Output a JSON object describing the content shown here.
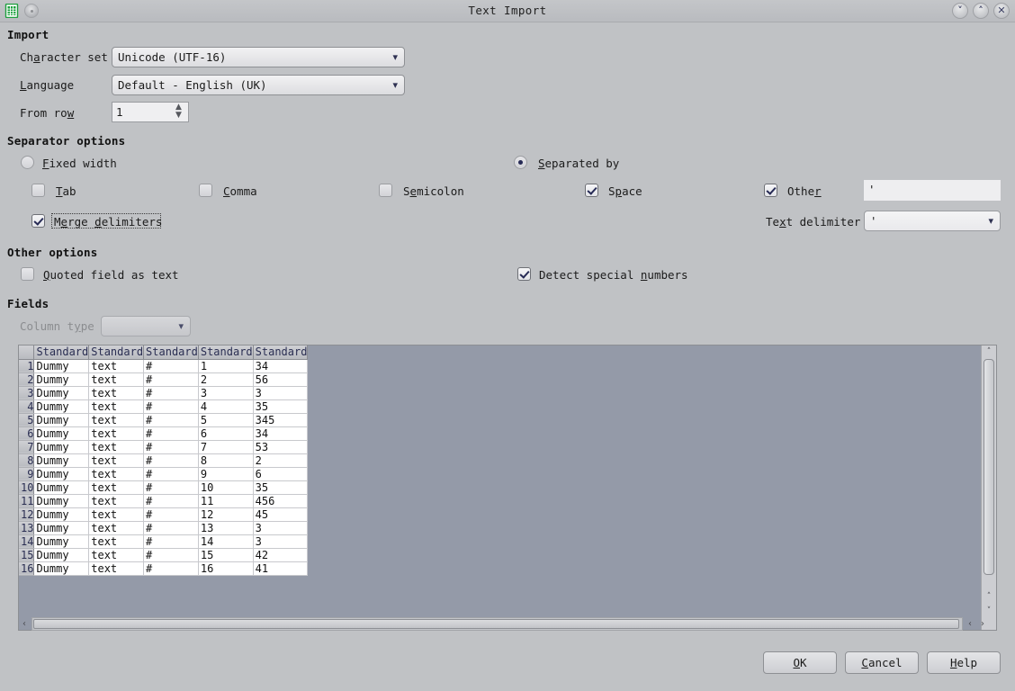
{
  "window": {
    "title": "Text Import",
    "app_icon": "calc-document-icon",
    "extra_icon": "round-button-icon",
    "controls": {
      "minimize": "˅",
      "maximize": "˄",
      "close": "✕"
    }
  },
  "import": {
    "heading": "Import",
    "charset_label": "Character set",
    "charset_value": "Unicode (UTF-16)",
    "language_label": "Language",
    "language_value": "Default - English (UK)",
    "fromrow_label": "From row",
    "fromrow_value": "1"
  },
  "separator": {
    "heading": "Separator options",
    "fixed_width_label": "Fixed width",
    "fixed_width_checked": false,
    "separated_by_label": "Separated by",
    "separated_by_checked": true,
    "tab_label": "Tab",
    "tab_checked": false,
    "comma_label": "Comma",
    "comma_checked": false,
    "semicolon_label": "Semicolon",
    "semicolon_checked": false,
    "space_label": "Space",
    "space_checked": true,
    "other_label": "Other",
    "other_checked": true,
    "other_value": "'",
    "merge_label": "Merge delimiters",
    "merge_checked": true,
    "text_delimiter_label": "Text delimiter",
    "text_delimiter_value": "'"
  },
  "other_options": {
    "heading": "Other options",
    "quoted_label": "Quoted field as text",
    "quoted_checked": false,
    "detect_label": "Detect special numbers",
    "detect_checked": true
  },
  "fields": {
    "heading": "Fields",
    "column_type_label": "Column type",
    "column_type_value": "",
    "column_type_disabled": true,
    "columns": [
      "Standard",
      "Standard",
      "Standard",
      "Standard",
      "Standard"
    ],
    "rows": [
      {
        "n": "1",
        "cells": [
          "Dummy",
          "text",
          "#",
          "1",
          "34"
        ]
      },
      {
        "n": "2",
        "cells": [
          "Dummy",
          "text",
          "#",
          "2",
          "56"
        ]
      },
      {
        "n": "3",
        "cells": [
          "Dummy",
          "text",
          "#",
          "3",
          "3"
        ]
      },
      {
        "n": "4",
        "cells": [
          "Dummy",
          "text",
          "#",
          "4",
          "35"
        ]
      },
      {
        "n": "5",
        "cells": [
          "Dummy",
          "text",
          "#",
          "5",
          "345"
        ]
      },
      {
        "n": "6",
        "cells": [
          "Dummy",
          "text",
          "#",
          "6",
          "34"
        ]
      },
      {
        "n": "7",
        "cells": [
          "Dummy",
          "text",
          "#",
          "7",
          "53"
        ]
      },
      {
        "n": "8",
        "cells": [
          "Dummy",
          "text",
          "#",
          "8",
          "2"
        ]
      },
      {
        "n": "9",
        "cells": [
          "Dummy",
          "text",
          "#",
          "9",
          "6"
        ]
      },
      {
        "n": "10",
        "cells": [
          "Dummy",
          "text",
          "#",
          "10",
          "35"
        ]
      },
      {
        "n": "11",
        "cells": [
          "Dummy",
          "text",
          "#",
          "11",
          "456"
        ]
      },
      {
        "n": "12",
        "cells": [
          "Dummy",
          "text",
          "#",
          "12",
          "45"
        ]
      },
      {
        "n": "13",
        "cells": [
          "Dummy",
          "text",
          "#",
          "13",
          "3"
        ]
      },
      {
        "n": "14",
        "cells": [
          "Dummy",
          "text",
          "#",
          "14",
          "3"
        ]
      },
      {
        "n": "15",
        "cells": [
          "Dummy",
          "text",
          "#",
          "15",
          "42"
        ]
      },
      {
        "n": "16",
        "cells": [
          "Dummy",
          "text",
          "#",
          "16",
          "41"
        ]
      }
    ]
  },
  "scrollbars": {
    "v_up": "˄",
    "v_down_1": "˄",
    "v_down_2": "˅",
    "h_left": "‹",
    "h_right_1": "‹",
    "h_right_2": "›"
  },
  "buttons": {
    "ok": "OK",
    "cancel": "Cancel",
    "help": "Help"
  },
  "colors": {
    "dialog_bg": "#c0c2c5",
    "preview_bg": "#949aa8",
    "header_text": "#2a2e52",
    "check_mark": "#262a55"
  }
}
